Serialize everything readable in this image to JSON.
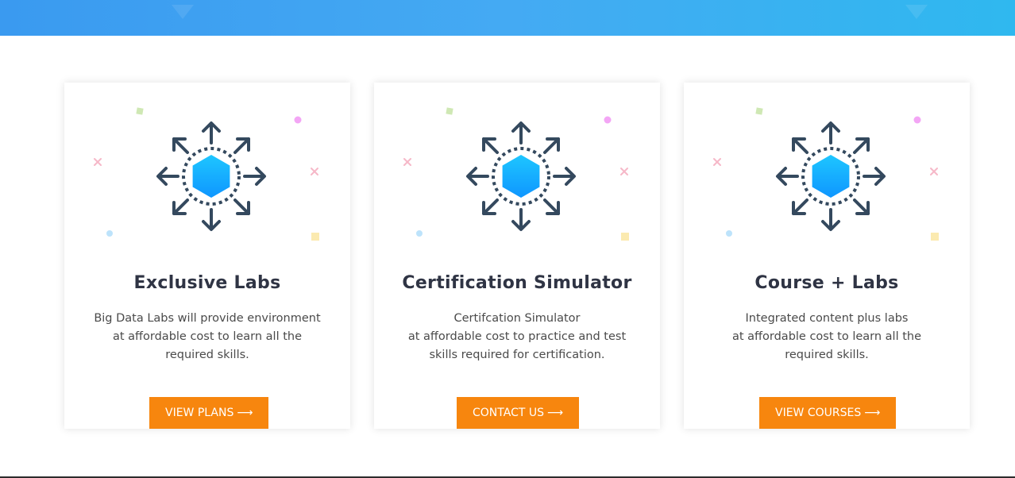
{
  "colors": {
    "banner": "#3a9af0",
    "button": "#f7860e",
    "title": "#2f3444",
    "icon_stroke": "#34495e",
    "hexagon": "#15aaff"
  },
  "icons": {
    "main": "expand-arrows-hexagon-icon",
    "button_arrow": "long-arrow-right-icon"
  },
  "cards": [
    {
      "title": "Exclusive Labs",
      "desc_lines": [
        "Big Data Labs will provide environment",
        "at affordable cost to learn all the",
        "required skills."
      ],
      "button_label": "VIEW PLANS",
      "button_arrow": "⟶"
    },
    {
      "title": "Certification Simulator",
      "desc_lines": [
        "Certifcation Simulator",
        "at affordable cost to practice and test",
        "skills required for certification."
      ],
      "button_label": "CONTACT US",
      "button_arrow": "⟶"
    },
    {
      "title": "Course + Labs",
      "desc_lines": [
        "Integrated content plus labs",
        "at affordable cost to learn all the",
        "required skills."
      ],
      "button_label": "VIEW COURSES",
      "button_arrow": "⟶"
    }
  ]
}
